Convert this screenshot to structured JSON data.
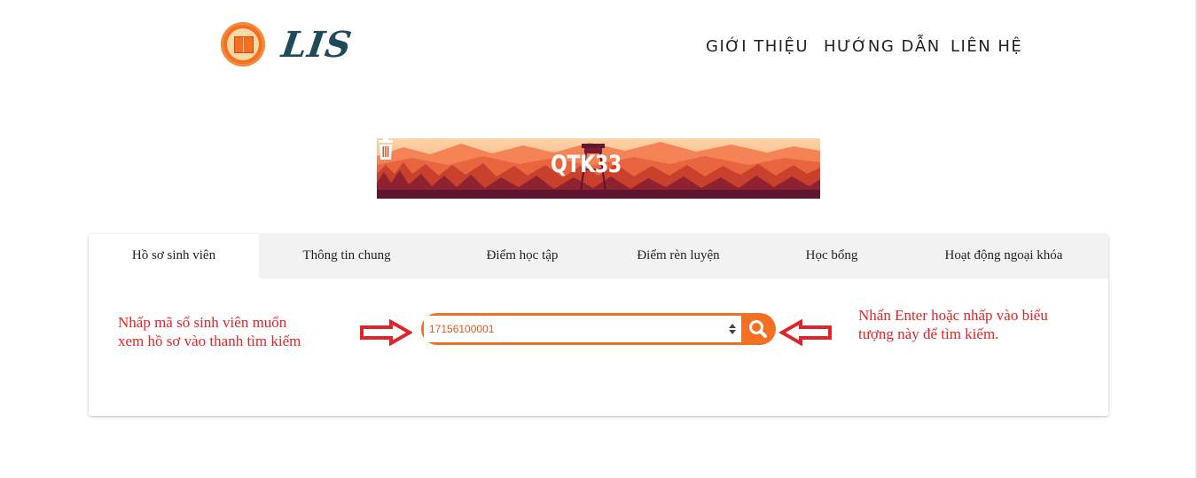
{
  "header": {
    "logo_text": "LIS",
    "nav": [
      "GIỚI THIỆU",
      "HƯỚNG DẪN",
      "LIÊN HỆ"
    ]
  },
  "banner": {
    "title": "QTK33",
    "icon": "trash-icon"
  },
  "tabs": [
    "Hồ sơ sinh viên",
    "Thông tin chung",
    "Điểm học tập",
    "Điểm rèn luyện",
    "Học bổng",
    "Hoạt động ngoại khóa"
  ],
  "active_tab": 0,
  "search": {
    "value": "17156100001",
    "button_icon": "search-icon"
  },
  "notes": {
    "left_line1": "Nhấp mã số sinh viên muốn",
    "left_line2": "xem hồ sơ vào thanh tìm kiếm",
    "right_line1": "Nhấn Enter hoặc nhấp vào biểu",
    "right_line2": "tượng này để tìm kiếm."
  },
  "colors": {
    "accent": "#f36f21",
    "annotation": "#e0252a"
  }
}
